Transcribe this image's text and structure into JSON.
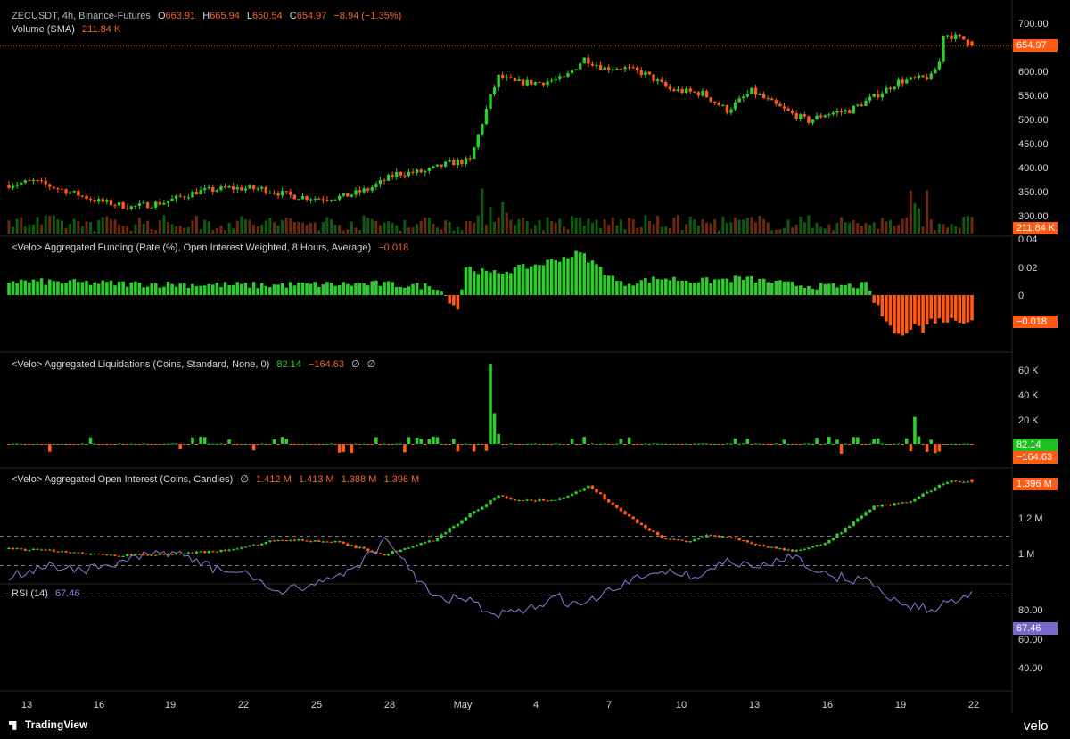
{
  "legends": {
    "price": {
      "symbol": "ZECUSDT, 4h, Binance-Futures",
      "o_label": "O",
      "o": "663.91",
      "h_label": "H",
      "h": "665.94",
      "l_label": "L",
      "l": "650.54",
      "c_label": "C",
      "c": "654.97",
      "change": "−8.94 (−1.35%)"
    },
    "volume": {
      "label": "Volume (SMA)",
      "value": "211.84 K"
    },
    "funding": {
      "label": "<Velo> Aggregated Funding (Rate (%), Open Interest Weighted, 8 Hours, Average)",
      "value": "−0.018"
    },
    "liquidations": {
      "label": "<Velo> Aggregated Liquidations (Coins, Standard, None, 0)",
      "long": "82.14",
      "short": "−164.63",
      "sym1": "∅",
      "sym2": "∅"
    },
    "oi": {
      "label": "<Velo> Aggregated Open Interest (Coins, Candles)",
      "sym": "∅",
      "o": "1.412 M",
      "h": "1.413 M",
      "l": "1.388 M",
      "c": "1.396 M"
    },
    "rsi": {
      "label": "RSI (14)",
      "value": "67.46"
    }
  },
  "axes": {
    "price_ticks": [
      "700.00",
      "650.00",
      "600.00",
      "550.00",
      "500.00",
      "450.00",
      "400.00",
      "350.00",
      "300.00"
    ],
    "funding_ticks": [
      "0.04",
      "0.02",
      "0"
    ],
    "liq_ticks": [
      "60 K",
      "40 K",
      "20 K"
    ],
    "oi_ticks": [
      "1.2 M",
      "1 M"
    ],
    "rsi_ticks": [
      "80.00",
      "60.00",
      "40.00"
    ],
    "x_labels": [
      "13",
      "16",
      "19",
      "22",
      "25",
      "28",
      "May",
      "4",
      "7",
      "10",
      "13",
      "16",
      "19",
      "22"
    ]
  },
  "tags": {
    "price": "654.97",
    "volume": "211.84 K",
    "funding": "−0.018",
    "liq_long": "82.14",
    "liq_short": "−164.63",
    "oi": "1.396 M",
    "rsi": "67.46"
  },
  "branding": {
    "tradingview": "TradingView",
    "velo": "velo"
  },
  "colors": {
    "up": "#2ecc2e",
    "down": "#ff5a14",
    "rsi": "#8e7cd6",
    "background": "#000000"
  },
  "chart_data": [
    {
      "type": "candlestick",
      "title": "ZECUSDT, 4h, Binance-Futures",
      "ylim": [
        290,
        720
      ],
      "x_range": [
        "Apr 13",
        "May 22"
      ],
      "key_points": [
        [
          0,
          365
        ],
        [
          6,
          372
        ],
        [
          14,
          352
        ],
        [
          22,
          330
        ],
        [
          30,
          318
        ],
        [
          38,
          328
        ],
        [
          46,
          350
        ],
        [
          54,
          358
        ],
        [
          62,
          356
        ],
        [
          69,
          342
        ],
        [
          76,
          336
        ],
        [
          82,
          340
        ],
        [
          88,
          355
        ],
        [
          95,
          388
        ],
        [
          102,
          392
        ],
        [
          108,
          410
        ],
        [
          113,
          415
        ],
        [
          118,
          548
        ],
        [
          120,
          590
        ],
        [
          124,
          578
        ],
        [
          130,
          578
        ],
        [
          136,
          586
        ],
        [
          141,
          628
        ],
        [
          146,
          608
        ],
        [
          150,
          610
        ],
        [
          156,
          596
        ],
        [
          162,
          563
        ],
        [
          170,
          555
        ],
        [
          176,
          520
        ],
        [
          182,
          560
        ],
        [
          188,
          530
        ],
        [
          192,
          512
        ],
        [
          196,
          498
        ],
        [
          200,
          512
        ],
        [
          206,
          520
        ],
        [
          212,
          548
        ],
        [
          218,
          580
        ],
        [
          226,
          590
        ],
        [
          228,
          622
        ],
        [
          229,
          680
        ],
        [
          234,
          668
        ],
        [
          236,
          655
        ]
      ],
      "last": {
        "open": 663.91,
        "high": 665.94,
        "low": 650.54,
        "close": 654.97
      }
    },
    {
      "type": "bar",
      "title": "Volume (SMA)",
      "last": "211.84 K"
    },
    {
      "type": "bar",
      "title": "<Velo> Aggregated Funding (Rate (%), Open Interest Weighted, 8 Hours, Average)",
      "ylim": [
        -0.06,
        0.04
      ],
      "key_points": [
        [
          0,
          0.01
        ],
        [
          30,
          0.008
        ],
        [
          60,
          0.007
        ],
        [
          90,
          0.008
        ],
        [
          105,
          0.006
        ],
        [
          110,
          -0.01
        ],
        [
          112,
          0.02
        ],
        [
          118,
          0.015
        ],
        [
          130,
          0.022
        ],
        [
          140,
          0.03
        ],
        [
          150,
          0.008
        ],
        [
          160,
          0.012
        ],
        [
          170,
          0.01
        ],
        [
          180,
          0.012
        ],
        [
          190,
          0.008
        ],
        [
          200,
          0.006
        ],
        [
          210,
          0.007
        ],
        [
          214,
          -0.015
        ],
        [
          218,
          -0.03
        ],
        [
          222,
          -0.02
        ],
        [
          224,
          -0.026
        ],
        [
          226,
          -0.018
        ]
      ],
      "last": -0.018
    },
    {
      "type": "bar",
      "title": "<Velo> Aggregated Liquidations (Coins, Standard, None, 0)",
      "ylim": [
        -15000,
        70000
      ],
      "spikes": [
        [
          104,
          6000
        ],
        [
          118,
          65000
        ],
        [
          119,
          25000
        ],
        [
          120,
          8000
        ],
        [
          222,
          22000
        ],
        [
          223,
          6000
        ]
      ],
      "last": {
        "long": 82.14,
        "short": -164.63
      }
    },
    {
      "type": "candlestick",
      "title": "<Velo> Aggregated Open Interest (Coins, Candles)",
      "ylim": [
        900000,
        1500000
      ],
      "key_points": [
        [
          0,
          1020000
        ],
        [
          12,
          1010000
        ],
        [
          24,
          985000
        ],
        [
          40,
          990000
        ],
        [
          56,
          1020000
        ],
        [
          66,
          1075000
        ],
        [
          80,
          1060000
        ],
        [
          92,
          990000
        ],
        [
          104,
          1070000
        ],
        [
          112,
          1200000
        ],
        [
          120,
          1320000
        ],
        [
          124,
          1290000
        ],
        [
          136,
          1300000
        ],
        [
          142,
          1380000
        ],
        [
          150,
          1230000
        ],
        [
          160,
          1080000
        ],
        [
          166,
          1060000
        ],
        [
          172,
          1100000
        ],
        [
          178,
          1080000
        ],
        [
          184,
          1040000
        ],
        [
          192,
          1010000
        ],
        [
          200,
          1050000
        ],
        [
          206,
          1150000
        ],
        [
          212,
          1260000
        ],
        [
          220,
          1280000
        ],
        [
          230,
          1400000
        ],
        [
          236,
          1396000
        ]
      ],
      "last": {
        "open": 1412000,
        "high": 1413000,
        "low": 1388000,
        "close": 1396000
      }
    },
    {
      "type": "line",
      "title": "RSI (14)",
      "ylim": [
        20,
        95
      ],
      "bands": [
        30,
        50,
        70
      ],
      "key_points": [
        [
          0,
          58
        ],
        [
          10,
          50
        ],
        [
          20,
          53
        ],
        [
          30,
          46
        ],
        [
          40,
          40
        ],
        [
          50,
          52
        ],
        [
          60,
          57
        ],
        [
          66,
          70
        ],
        [
          74,
          62
        ],
        [
          80,
          58
        ],
        [
          86,
          48
        ],
        [
          92,
          34
        ],
        [
          98,
          50
        ],
        [
          104,
          73
        ],
        [
          112,
          72
        ],
        [
          118,
          84
        ],
        [
          126,
          82
        ],
        [
          134,
          71
        ],
        [
          140,
          78
        ],
        [
          150,
          64
        ],
        [
          160,
          52
        ],
        [
          168,
          58
        ],
        [
          176,
          47
        ],
        [
          184,
          52
        ],
        [
          192,
          42
        ],
        [
          200,
          57
        ],
        [
          210,
          60
        ],
        [
          218,
          75
        ],
        [
          222,
          78
        ],
        [
          226,
          80
        ],
        [
          236,
          67.46
        ]
      ],
      "last": 67.46
    }
  ]
}
